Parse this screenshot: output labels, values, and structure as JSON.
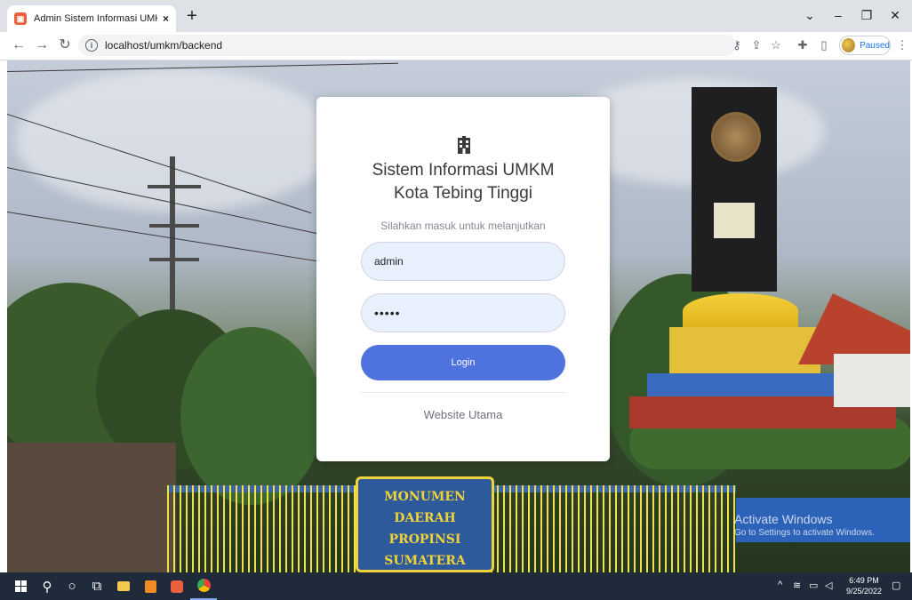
{
  "browser": {
    "tab_title": "Admin Sistem Informasi UMKM",
    "tab_close": "×",
    "new_tab": "+",
    "url": "localhost/umkm/backend",
    "profile_status": "Paused",
    "window_controls": {
      "dropdown": "⌄",
      "minimize": "–",
      "restore": "❐",
      "close": "✕"
    }
  },
  "login": {
    "title_line1": "Sistem Informasi UMKM",
    "title_line2": "Kota Tebing Tinggi",
    "subtitle": "Silahkan masuk untuk melanjutkan",
    "username_value": "admin",
    "password_value": "•••••",
    "login_button": "Login",
    "website_link": "Website Utama"
  },
  "background": {
    "sign_text": "MONUMEN DAERAH PROPINSI SUMATERA UTARA",
    "watermark_title": "Activate Windows",
    "watermark_sub": "Go to Settings to activate Windows."
  },
  "taskbar": {
    "time": "6:49 PM",
    "date": "9/25/2022"
  },
  "colors": {
    "primary": "#4e73df",
    "input_bg": "#e8f0fe",
    "taskbar": "#1f2b3a"
  }
}
